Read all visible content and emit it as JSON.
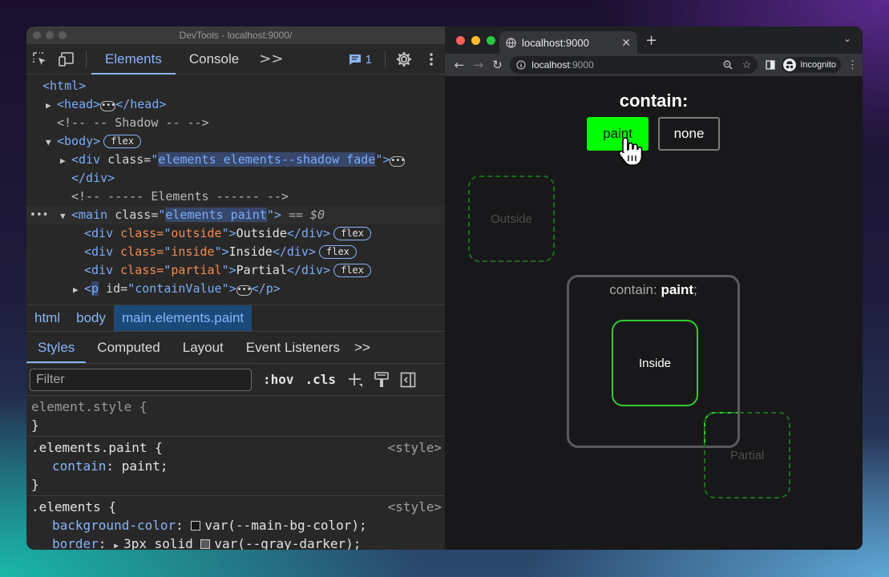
{
  "devtools": {
    "title": "DevTools - localhost:9000/",
    "toolbar": {
      "tabs": [
        "Elements",
        "Console"
      ],
      "more": ">>",
      "issues_count": "1"
    },
    "dom": {
      "html_open": "<html>",
      "head_open": "<head>",
      "head_close": "</head>",
      "comment_shadow": "<!-- -- Shadow -- -->",
      "body_open": "<body>",
      "badge_flex": "flex",
      "div1_open": "<div ",
      "div1_attr": "class=",
      "div1_val": "elements elements--shadow fade",
      "div1_end": ">",
      "div1_close": "</div>",
      "comment_elements": "<!-- ----- Elements ------ -->",
      "main_open": "<main ",
      "main_attr": "class=",
      "main_val": "elements paint",
      "main_end": ">",
      "main_eq": "== $0",
      "row_outside": {
        "open": "<div ",
        "attr": "class=",
        "val": "outside",
        "end": ">",
        "text": "Outside",
        "close": "</div>"
      },
      "row_inside": {
        "open": "<div ",
        "attr": "class=",
        "val": "inside",
        "end": ">",
        "text": "Inside",
        "close": "</div>"
      },
      "row_partial": {
        "open": "<div ",
        "attr": "class=",
        "val": "partial",
        "end": ">",
        "text": "Partial",
        "close": "</div>"
      },
      "p_open": "<",
      "p_tag": "p",
      "p_attr": " id=",
      "p_val": "containValue",
      "p_end": ">",
      "p_close": "</p>"
    },
    "breadcrumbs": [
      "html",
      "body",
      "main",
      ".elements.paint"
    ],
    "styles_tabs": [
      "Styles",
      "Computed",
      "Layout",
      "Event Listeners",
      ">>"
    ],
    "filter": {
      "placeholder": "Filter",
      "hov": ":hov",
      "cls": ".cls"
    },
    "rules": {
      "r1_selector": "element.style {",
      "r1_close": "}",
      "r2_selector": ".elements.paint {",
      "r2_source": "<style>",
      "r2_prop": "contain",
      "r2_value": "paint;",
      "r2_close": "}",
      "r3_selector": ".elements {",
      "r3_source": "<style>",
      "r3_prop1": "background-color",
      "r3_value1": "var(--main-bg-color);",
      "r3_prop2": "border",
      "r3_value2_pre": "3px solid",
      "r3_value2": "var(--gray-darker);"
    }
  },
  "browser": {
    "tab_title": "localhost:9000",
    "url_host": "localhost",
    "url_port": ":9000",
    "incognito_label": "Incognito",
    "page": {
      "title": "contain:",
      "btn_paint": "paint",
      "btn_none": "none",
      "outside_label": "Outside",
      "main_label_prefix": "contain: ",
      "main_label_value": "paint",
      "main_label_suffix": ";",
      "inside_label": "Inside",
      "partial_label": "Partial"
    }
  },
  "colors": {
    "accent_blue": "#8ab4f8",
    "paint_green": "#00ff00",
    "inside_border_green": "#33cc33"
  }
}
